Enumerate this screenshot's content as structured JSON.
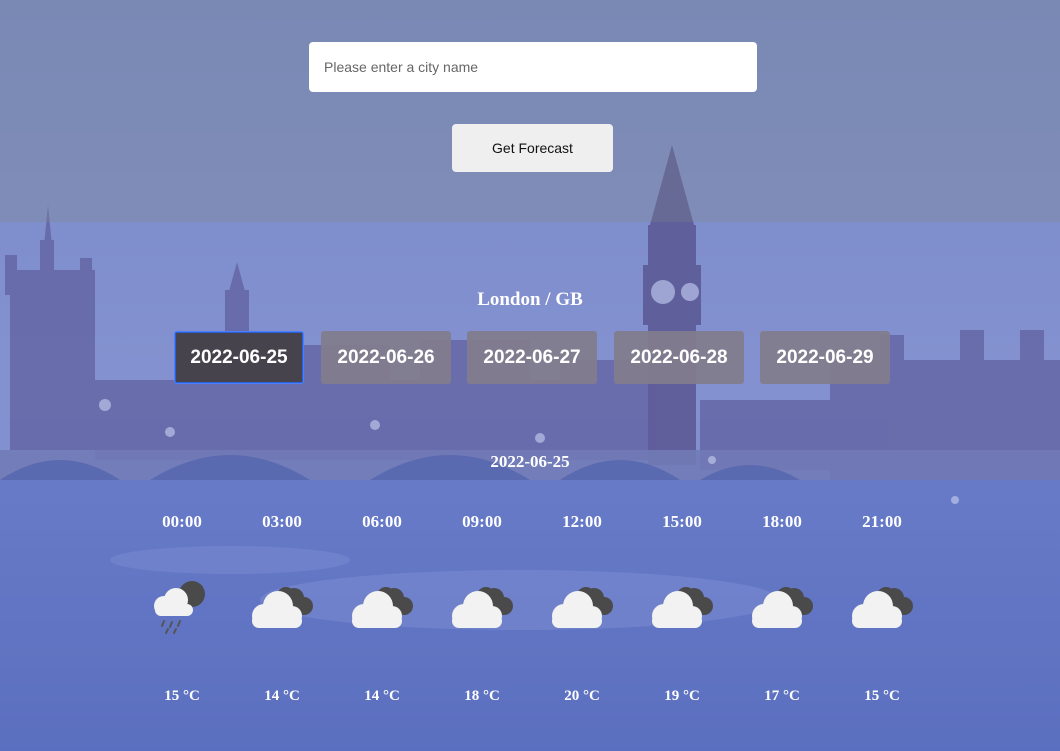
{
  "search": {
    "placeholder": "Please enter a city name",
    "value": "",
    "button_label": "Get Forecast"
  },
  "location": "London / GB",
  "dates": [
    "2022-06-25",
    "2022-06-26",
    "2022-06-27",
    "2022-06-28",
    "2022-06-29"
  ],
  "active_date_index": 0,
  "selected_date": "2022-06-25",
  "hours": [
    {
      "time": "00:00",
      "icon": "cloud-rain-icon",
      "temp": "15 °C"
    },
    {
      "time": "03:00",
      "icon": "cloud-icon",
      "temp": "14 °C"
    },
    {
      "time": "06:00",
      "icon": "cloud-icon",
      "temp": "14 °C"
    },
    {
      "time": "09:00",
      "icon": "cloud-icon",
      "temp": "18 °C"
    },
    {
      "time": "12:00",
      "icon": "cloud-icon",
      "temp": "20 °C"
    },
    {
      "time": "15:00",
      "icon": "cloud-icon",
      "temp": "19 °C"
    },
    {
      "time": "18:00",
      "icon": "cloud-icon",
      "temp": "17 °C"
    },
    {
      "time": "21:00",
      "icon": "cloud-icon",
      "temp": "15 °C"
    }
  ],
  "colors": {
    "active_tab": "#47434d",
    "inactive_tab": "#827d8c",
    "panel_tint": "#5f73cd"
  }
}
